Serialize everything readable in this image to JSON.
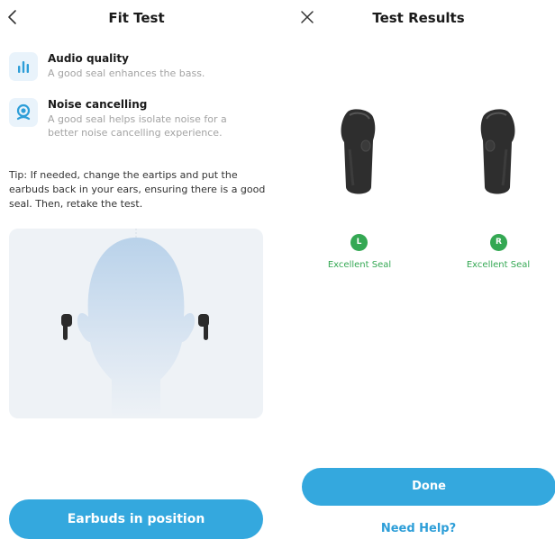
{
  "fit_test": {
    "title": "Fit Test",
    "features": [
      {
        "title": "Audio quality",
        "description": "A good seal enhances the bass.",
        "icon": "equalizer-icon"
      },
      {
        "title": "Noise cancelling",
        "description": "A good seal helps isolate noise for a better noise cancelling experience.",
        "icon": "noise-cancel-icon"
      }
    ],
    "tip": "Tip: If needed, change the eartips and put the earbuds back in your ears, ensuring there is a good seal. Then, retake the test.",
    "button_label": "Earbuds in position"
  },
  "test_results": {
    "title": "Test Results",
    "left": {
      "badge": "L",
      "status": "Excellent Seal"
    },
    "right": {
      "badge": "R",
      "status": "Excellent Seal"
    },
    "done_label": "Done",
    "help_label": "Need Help?"
  },
  "colors": {
    "accent": "#34a8de",
    "success": "#34a853",
    "link": "#2d9ed8",
    "muted": "#a3a3a3"
  }
}
